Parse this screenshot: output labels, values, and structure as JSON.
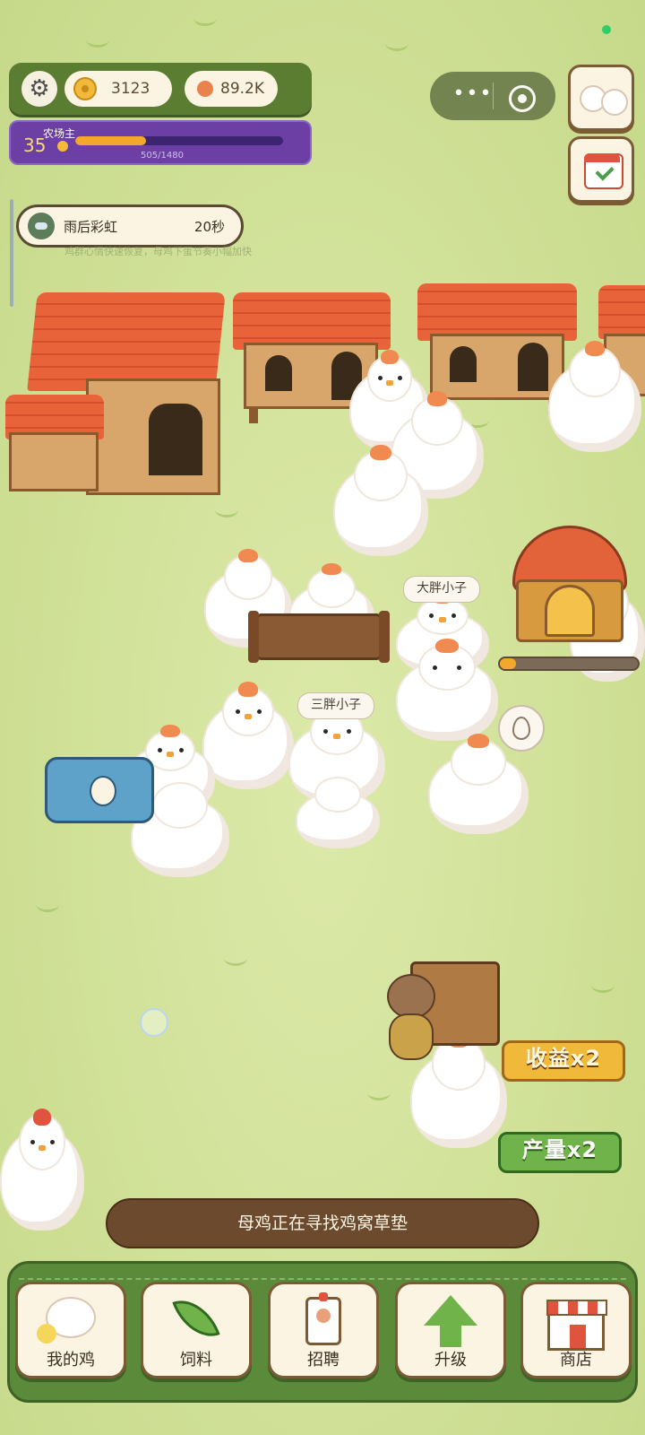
{
  "hud": {
    "coins": "3123",
    "eggs": "89.2K"
  },
  "level": {
    "number": "35",
    "title": "农场主",
    "progress_text": "505/1480",
    "progress_fraction": 0.341
  },
  "weather": {
    "name": "雨后彩虹",
    "timer": "20秒",
    "subtitle": "鸡群心情快速恢复，母鸡下蛋节奏小幅加快"
  },
  "chickens": {
    "name_a": "大胖小子",
    "name_b": "三胖小子"
  },
  "boosts": {
    "income": "收益x2",
    "output": "产量x2"
  },
  "oven": {
    "progress_fraction": 0.12
  },
  "status_message": "母鸡正在寻找鸡窝草垫",
  "capsule": {
    "more": "•••"
  },
  "nav": [
    {
      "label": "我的鸡",
      "icon": "chicken-icon"
    },
    {
      "label": "饲料",
      "icon": "leaf-icon"
    },
    {
      "label": "招聘",
      "icon": "badge-icon"
    },
    {
      "label": "升级",
      "icon": "arrow-up-icon"
    },
    {
      "label": "商店",
      "icon": "shop-icon"
    }
  ],
  "colors": {
    "hud_green": "#5b7d32",
    "level_purple": "#6b3fa3",
    "nav_green": "#5b8a3a",
    "progress_orange": "#f3a72c"
  }
}
